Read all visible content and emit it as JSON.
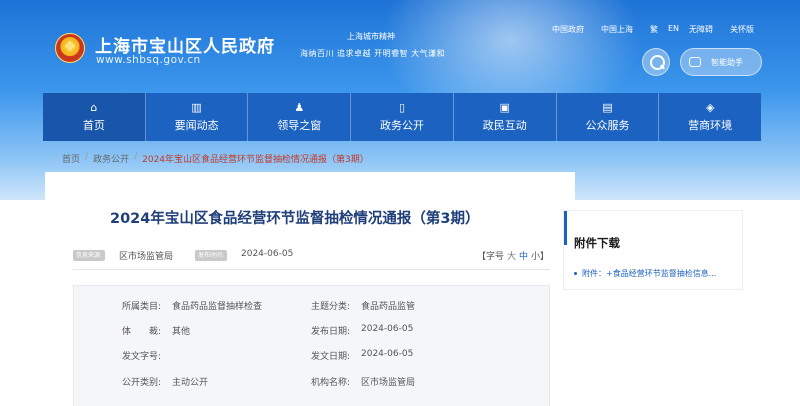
{
  "header": {
    "site_name": "上海市宝山区人民政府",
    "site_url": "www.shbsq.gov.cn",
    "spirit_title": "上海城市精神",
    "spirit_text": "海纳百川 追求卓越 开明睿智 大气谦和",
    "top_links": [
      "中国政府",
      "中国上海",
      "繁",
      "EN",
      "无障碍",
      "关怀版"
    ],
    "assistant_label": "智能助手"
  },
  "nav": {
    "items": [
      {
        "label": "首页",
        "icon": "home-icon",
        "glyph": "⌂"
      },
      {
        "label": "要闻动态",
        "icon": "columns-icon",
        "glyph": "▥"
      },
      {
        "label": "领导之窗",
        "icon": "person-icon",
        "glyph": "♟"
      },
      {
        "label": "政务公开",
        "icon": "document-icon",
        "glyph": "▯"
      },
      {
        "label": "政民互动",
        "icon": "chat-icon",
        "glyph": "▣"
      },
      {
        "label": "公众服务",
        "icon": "service-icon",
        "glyph": "▤"
      },
      {
        "label": "营商环境",
        "icon": "layers-icon",
        "glyph": "◈"
      }
    ]
  },
  "breadcrumb": {
    "items": [
      "首页",
      "政务公开",
      "2024年宝山区食品经营环节监督抽检情况通报（第3期）"
    ]
  },
  "article": {
    "title": "2024年宝山区食品经营环节监督抽检情况通报（第3期）",
    "source_tag": "信息来源:",
    "source": "区市场监管局",
    "date_tag": "发布时间:",
    "date": "2024-06-05",
    "font_size_label": "【字号",
    "font_big": "大",
    "font_mid": "中",
    "font_small": "小】"
  },
  "info": {
    "category_label": "所属类目:",
    "category_value": "食品药品监督抽样检查",
    "topic_label": "主题分类:",
    "topic_value": "食品药品监管",
    "genre_label": "体　　裁:",
    "genre_value": "其他",
    "pub_date_label": "发布日期:",
    "pub_date_value": "2024-06-05",
    "doc_no_label": "发文字号:",
    "doc_no_value": "",
    "doc_date_label": "发文日期:",
    "doc_date_value": "2024-06-05",
    "public_label": "公开类别:",
    "public_value": "主动公开",
    "org_label": "机构名称:",
    "org_value": "区市场监管局"
  },
  "sidebar": {
    "title": "附件下载",
    "attachment": "附件：+食品经营环节监督抽检信息..."
  }
}
